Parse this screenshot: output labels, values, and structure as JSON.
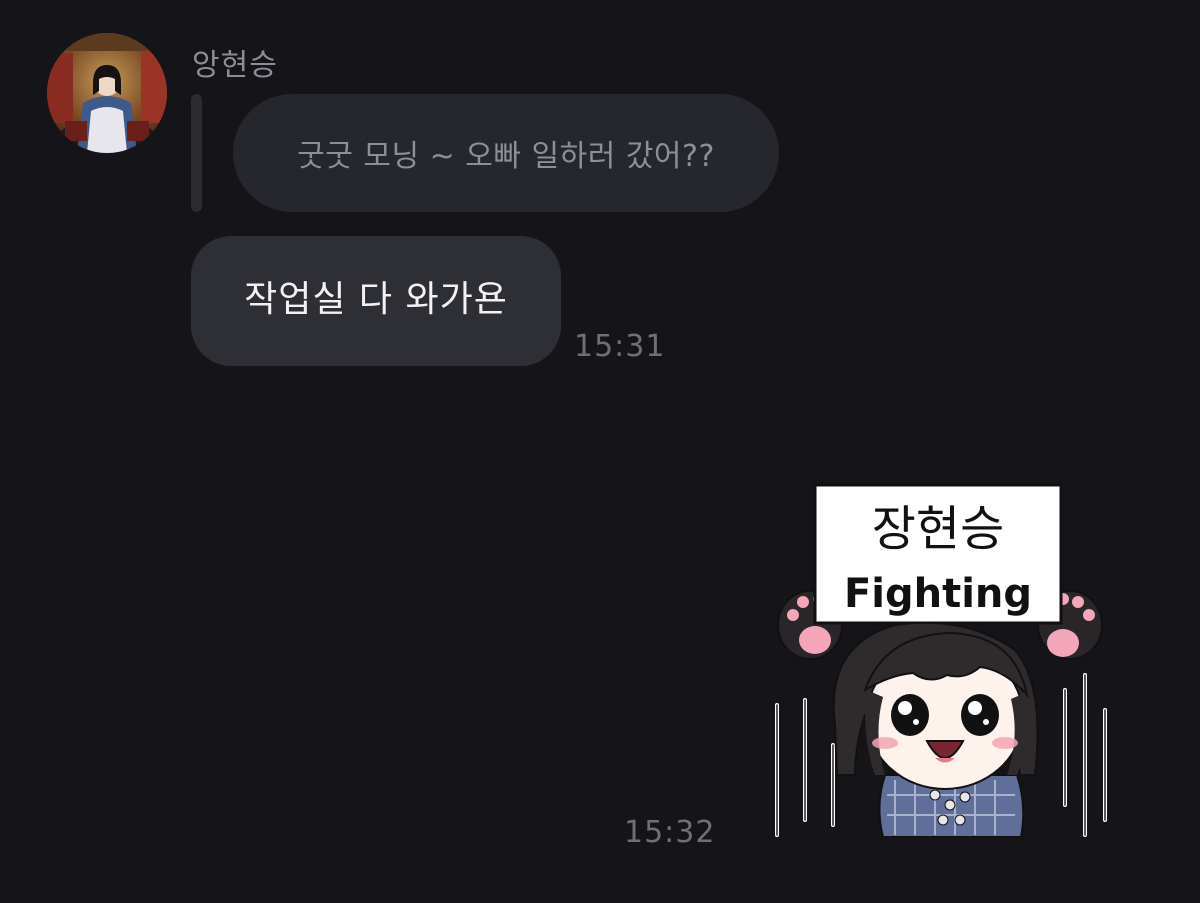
{
  "conversation": {
    "sender_name": "앙현승",
    "avatar_icon": "profile-photo",
    "quoted_message": "굿굿 모닝 ~ 오빠 일하러 갔어??",
    "reply_message": "작업실 다 와가욘",
    "reply_time": "15:31",
    "sticker": {
      "icon": "fighting-sign-sticker",
      "sign_line_1": "장현승",
      "sign_line_2": "Fighting"
    },
    "sticker_time": "15:32"
  },
  "colors": {
    "background": "#141419",
    "quoted_bubble": "#26272d",
    "message_bubble": "#2e2f35",
    "message_text": "#f2f2f5",
    "muted_text": "#8e8e96",
    "timestamp": "#6f6f77"
  }
}
